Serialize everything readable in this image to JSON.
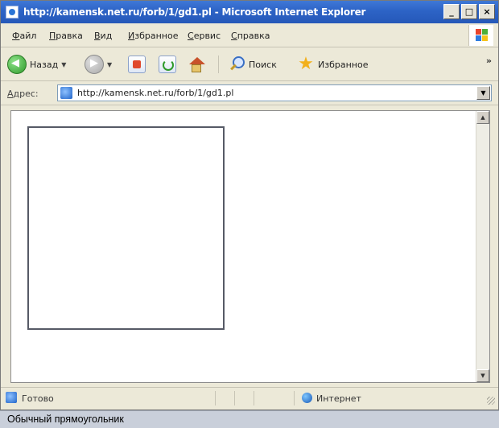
{
  "window": {
    "title": "http://kamensk.net.ru/forb/1/gd1.pl - Microsoft Internet Explorer",
    "controls": {
      "minimize": "_",
      "maximize": "□",
      "close": "×"
    }
  },
  "menubar": {
    "items": [
      "Файл",
      "Правка",
      "Вид",
      "Избранное",
      "Сервис",
      "Справка"
    ]
  },
  "toolbar": {
    "back_label": "Назад",
    "search_label": "Поиск",
    "favorites_label": "Избранное",
    "more": "»"
  },
  "addressbar": {
    "label": "Адрес:",
    "url": "http://kamensk.net.ru/forb/1/gd1.pl"
  },
  "statusbar": {
    "status": "Готово",
    "zone": "Интернет"
  },
  "caption": "Обычный прямоугольник",
  "colors": {
    "titlebar": "#2d63c6",
    "chrome": "#ece9d8",
    "rectangle_border": "#565a66",
    "caption_bg": "#c9cfda"
  },
  "icons": {
    "back": "back-arrow-icon",
    "forward": "forward-arrow-icon",
    "stop": "stop-icon",
    "refresh": "refresh-icon",
    "home": "home-icon",
    "search": "search-icon",
    "favorites": "star-icon",
    "page": "ie-page-icon",
    "zone": "internet-globe-icon"
  }
}
